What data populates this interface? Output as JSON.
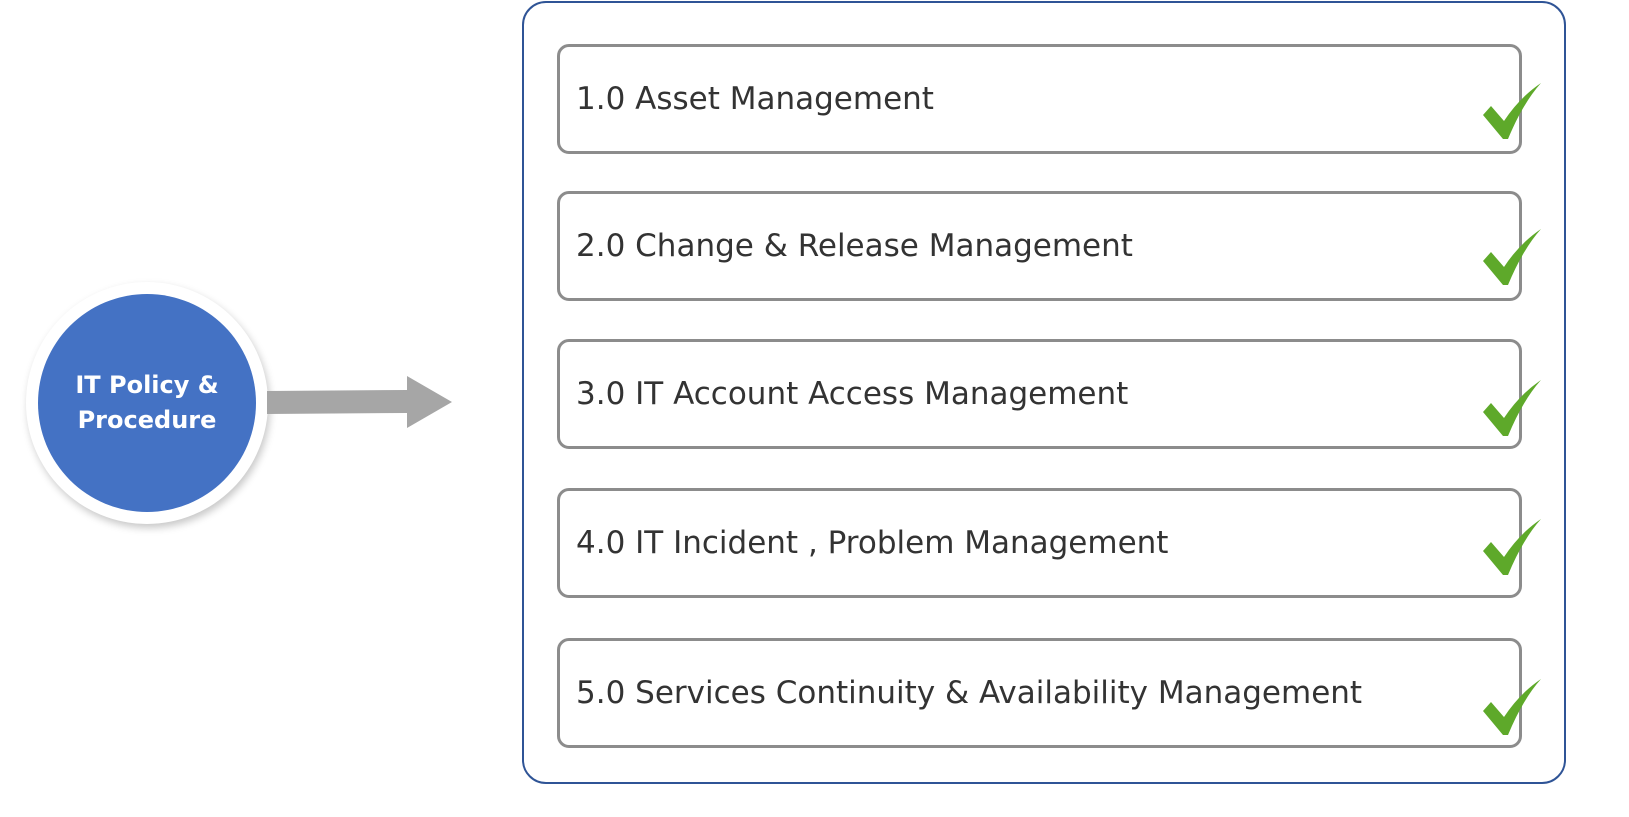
{
  "hub": {
    "label": "IT Policy &\nProcedure",
    "color": "#4472C4"
  },
  "connector": {
    "icon": "arrow-right-icon",
    "color": "#A6A6A6"
  },
  "container": {
    "border_color": "#2F5496"
  },
  "items": [
    {
      "label": "1.0 Asset Management",
      "status": "complete",
      "icon": "check-icon"
    },
    {
      "label": "2.0 Change & Release Management",
      "status": "complete",
      "icon": "check-icon"
    },
    {
      "label": "3.0 IT Account Access Management",
      "status": "complete",
      "icon": "check-icon"
    },
    {
      "label": "4.0 IT Incident , Problem Management",
      "status": "complete",
      "icon": "check-icon"
    },
    {
      "label": "5.0 Services Continuity & Availability Management",
      "status": "complete",
      "icon": "check-icon"
    }
  ],
  "colors": {
    "check": "#5EA92A",
    "item_border": "#8C8C8C",
    "text": "#333333"
  }
}
